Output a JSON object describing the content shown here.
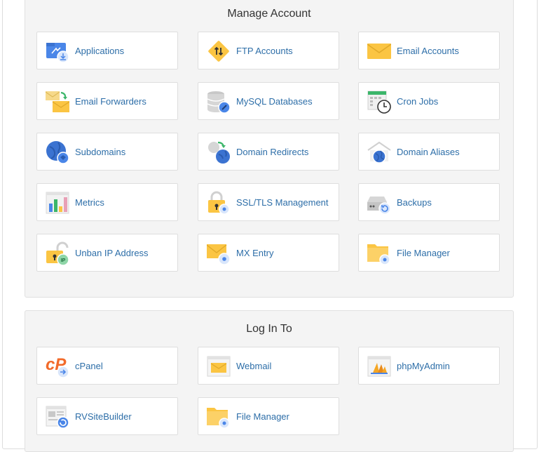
{
  "manage_account": {
    "title": "Manage Account",
    "items": [
      {
        "label": "Applications"
      },
      {
        "label": "FTP Accounts"
      },
      {
        "label": "Email Accounts"
      },
      {
        "label": "Email Forwarders"
      },
      {
        "label": "MySQL Databases"
      },
      {
        "label": "Cron Jobs"
      },
      {
        "label": "Subdomains"
      },
      {
        "label": "Domain Redirects"
      },
      {
        "label": "Domain Aliases"
      },
      {
        "label": "Metrics"
      },
      {
        "label": "SSL/TLS Management"
      },
      {
        "label": "Backups"
      },
      {
        "label": "Unban IP Address"
      },
      {
        "label": "MX Entry"
      },
      {
        "label": "File Manager"
      }
    ]
  },
  "log_in_to": {
    "title": "Log In To",
    "items": [
      {
        "label": "cPanel"
      },
      {
        "label": "Webmail"
      },
      {
        "label": "phpMyAdmin"
      },
      {
        "label": "RVSiteBuilder"
      },
      {
        "label": "File Manager"
      }
    ]
  },
  "colors": {
    "accent_blue": "#2d6ea8",
    "icon_blue": "#4a86e8",
    "icon_yellow": "#fbc543",
    "cpanel_orange": "#f26a2a"
  }
}
